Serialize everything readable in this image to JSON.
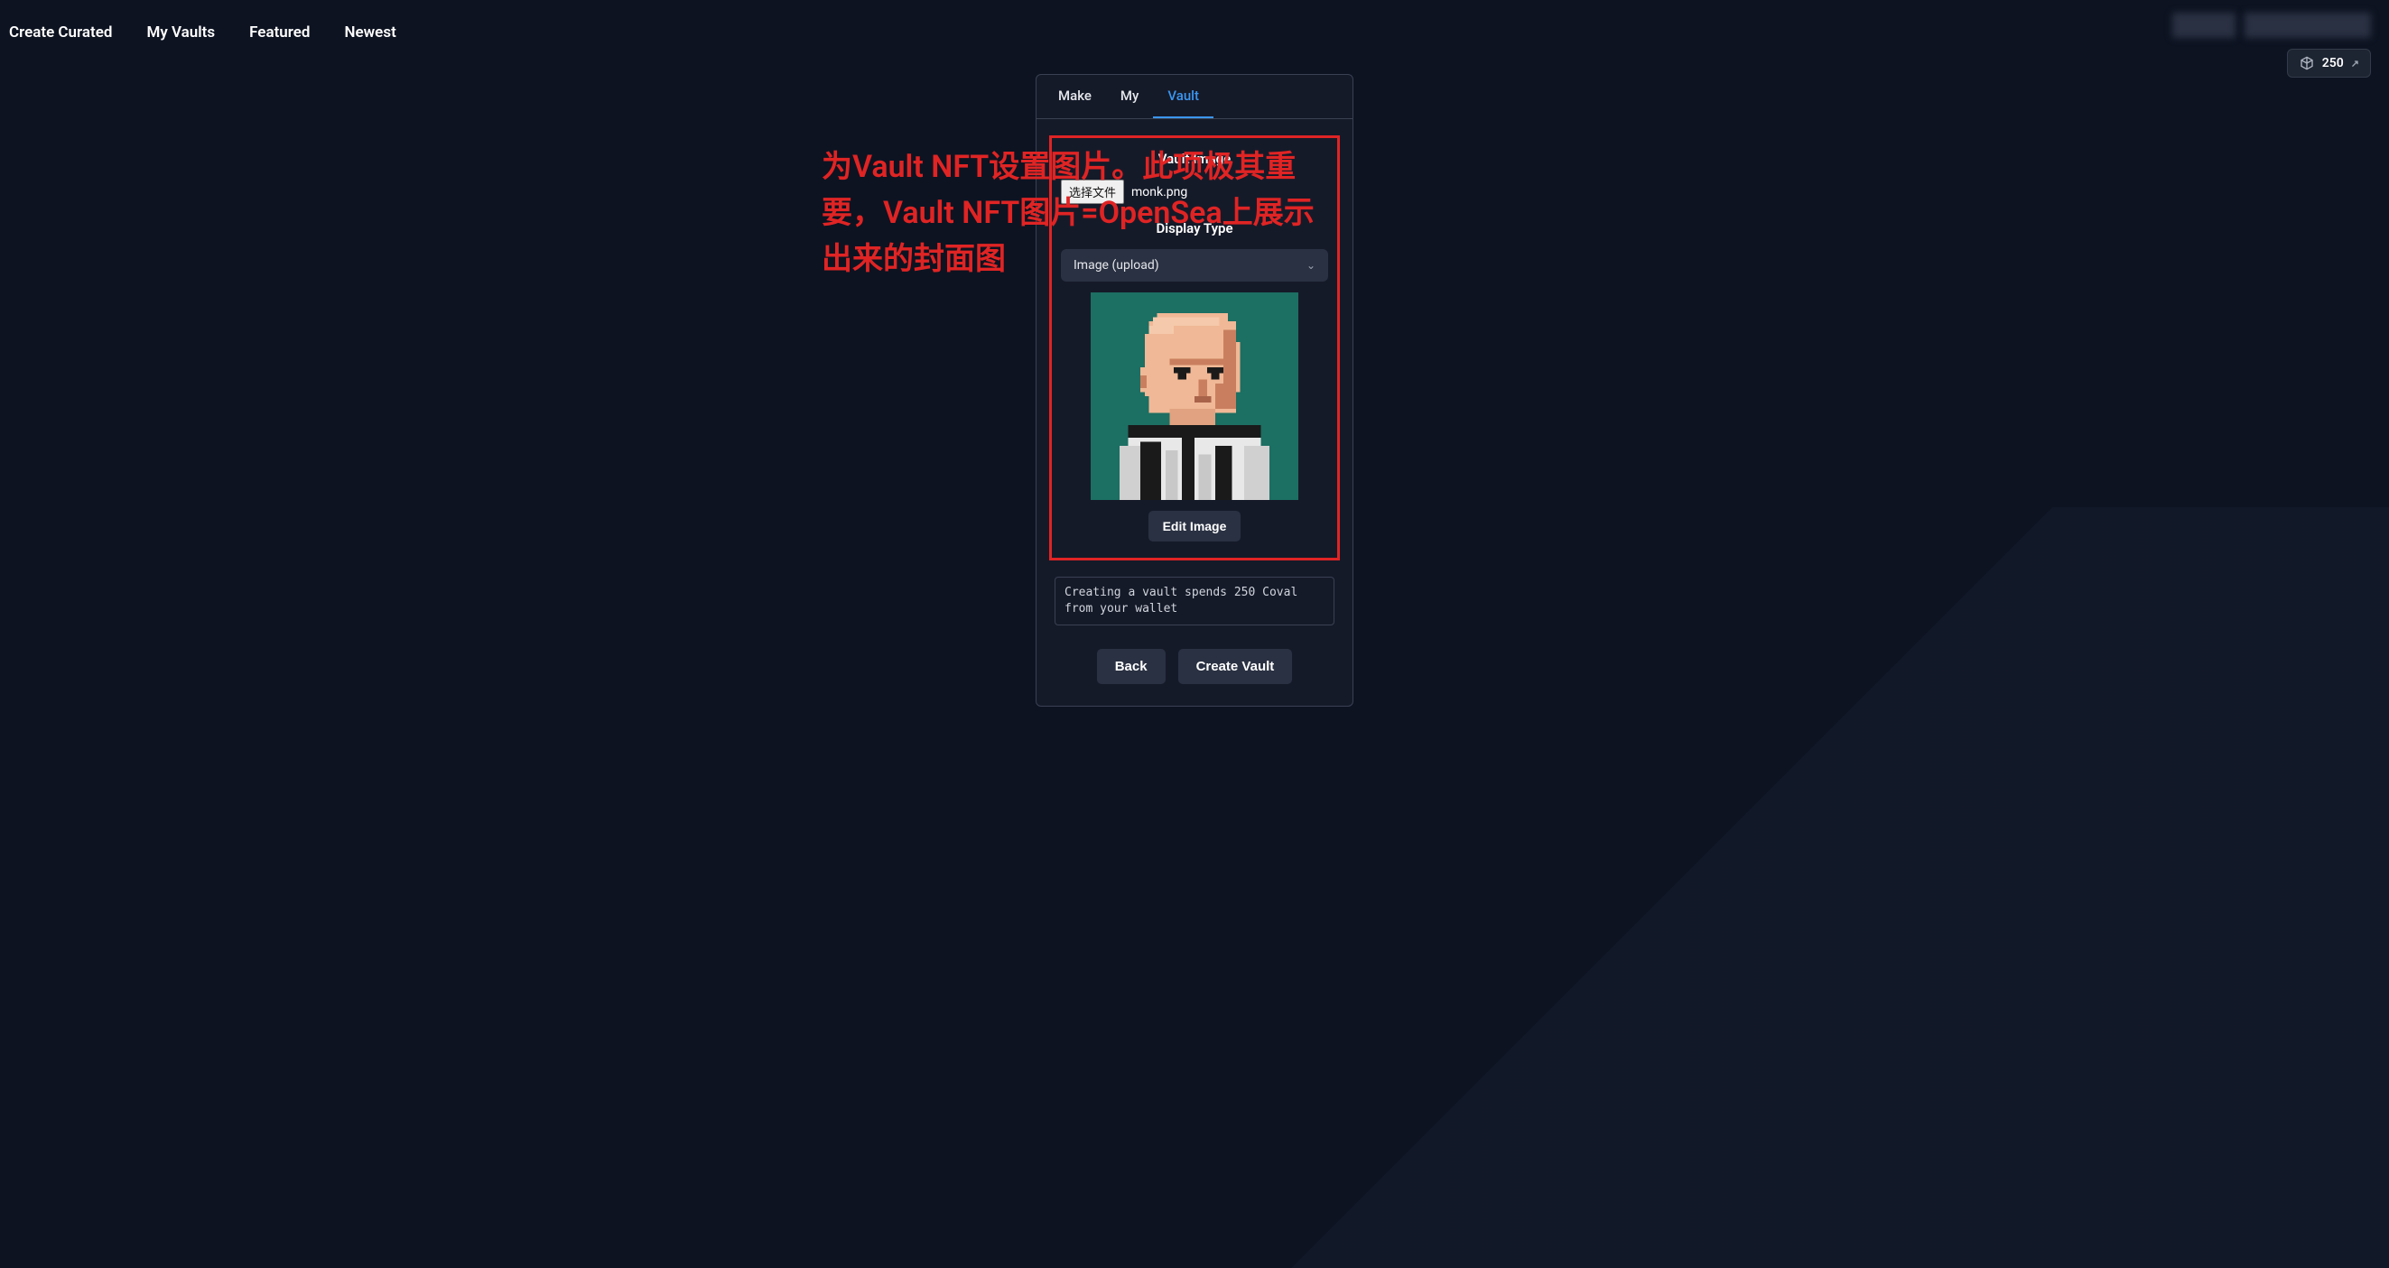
{
  "nav": {
    "items": [
      "Create Curated",
      "My Vaults",
      "Featured",
      "Newest"
    ]
  },
  "token_badge": {
    "amount": "250",
    "icon": "cube-icon",
    "external": "↗"
  },
  "panel": {
    "tabs": [
      {
        "label": "Make",
        "active": false
      },
      {
        "label": "My",
        "active": false
      },
      {
        "label": "Vault",
        "active": true
      }
    ],
    "vault_image": {
      "label": "Vault Image",
      "file_button": "选择文件",
      "file_name": "monk.png"
    },
    "display_type": {
      "label": "Display Type",
      "selected": "Image (upload)"
    },
    "edit_button": "Edit Image",
    "info_text": "Creating a vault spends 250 Coval from your wallet",
    "back_button": "Back",
    "create_button": "Create Vault"
  },
  "annotation": {
    "text": "为Vault NFT设置图片。此项极其重要，Vault NFT图片=OpenSea上展示出来的封面图"
  }
}
